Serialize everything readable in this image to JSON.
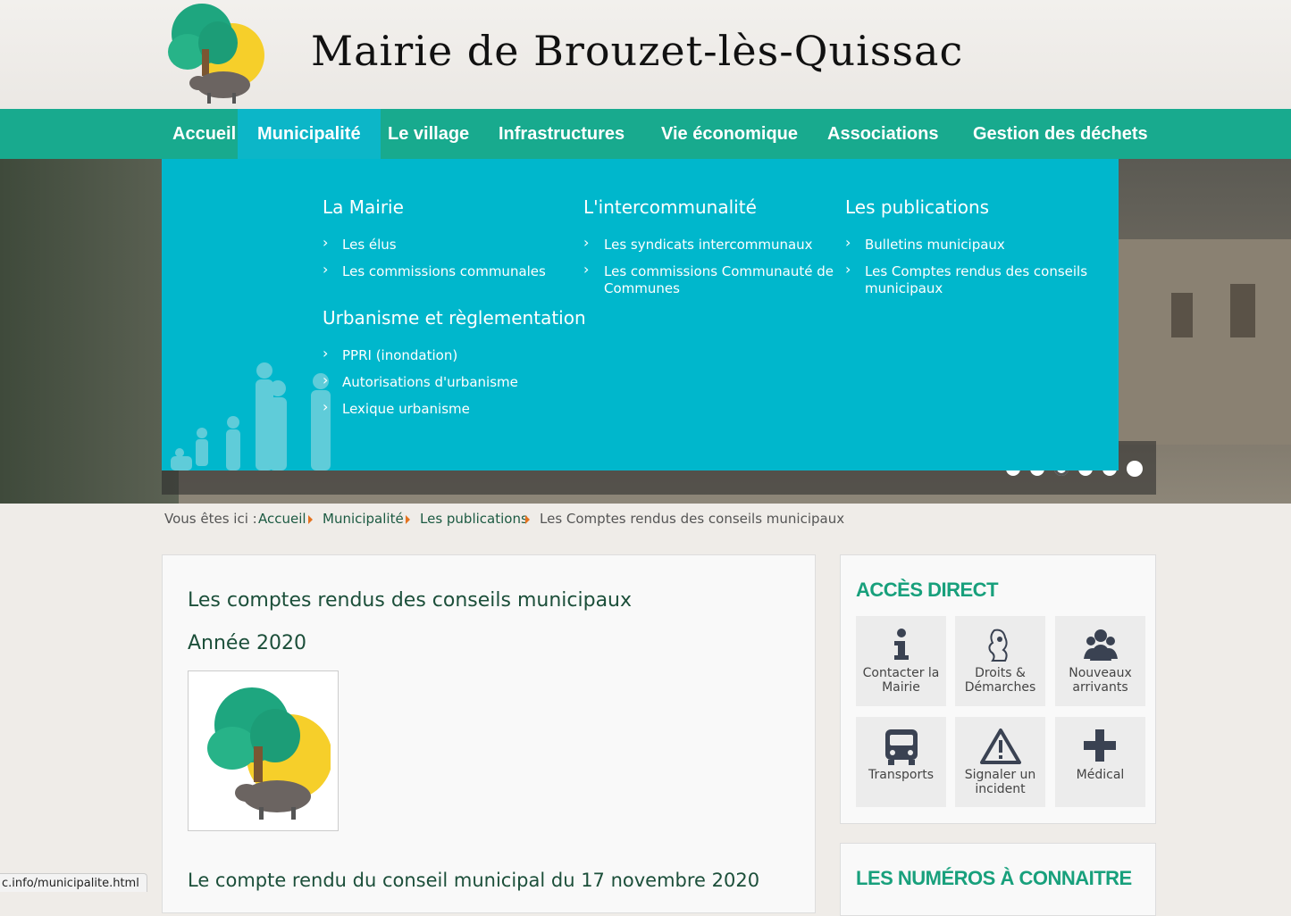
{
  "header": {
    "title": "Mairie de Brouzet-lès-Quissac"
  },
  "nav": {
    "items": [
      "Accueil",
      "Municipalité",
      "Le village",
      "Infrastructures",
      "Vie économique",
      "Associations",
      "Gestion des déchets"
    ]
  },
  "mega": {
    "columns": [
      {
        "title": "La Mairie",
        "links": [
          "Les élus",
          "Les commissions communales"
        ]
      },
      {
        "title": "L'intercommunalité",
        "links": [
          "Les syndicats intercommunaux",
          "Les commissions Communauté de Communes"
        ]
      },
      {
        "title": "Les publications",
        "links": [
          "Bulletins municipaux",
          "Les Comptes rendus des conseils municipaux"
        ]
      },
      {
        "title": "Urbanisme et règlementation",
        "links": [
          "PPRI (inondation)",
          "Autorisations d'urbanisme",
          "Lexique urbanisme"
        ]
      }
    ]
  },
  "breadcrumb": {
    "prefix": "Vous êtes ici :",
    "items": [
      "Accueil",
      "Municipalité",
      "Les publications",
      "Les Comptes rendus des conseils municipaux"
    ]
  },
  "main": {
    "title": "Les comptes rendus des conseils municipaux",
    "year": "Année 2020",
    "first_item": "Le compte rendu du conseil municipal du 17 novembre 2020"
  },
  "sidebar": {
    "title": "Accès direct",
    "tiles": [
      {
        "label": "Contacter la Mairie",
        "icon": "info-icon"
      },
      {
        "label": "Droits & Démarches",
        "icon": "marianne-icon"
      },
      {
        "label": "Nouveaux arrivants",
        "icon": "people-icon"
      },
      {
        "label": "Transports",
        "icon": "bus-icon"
      },
      {
        "label": "Signaler un incident",
        "icon": "warning-icon"
      },
      {
        "label": "Médical",
        "icon": "plus-icon"
      }
    ],
    "numbers_title": "LES NUMÉROS À CONNAITRE"
  },
  "status_bar": {
    "url": "c.info/municipalite.html"
  },
  "colors": {
    "nav": "#18aa8e",
    "mega": "#00b7cc",
    "heading_green": "#18a07c",
    "breadcrumb_arrow": "#e4731f"
  }
}
